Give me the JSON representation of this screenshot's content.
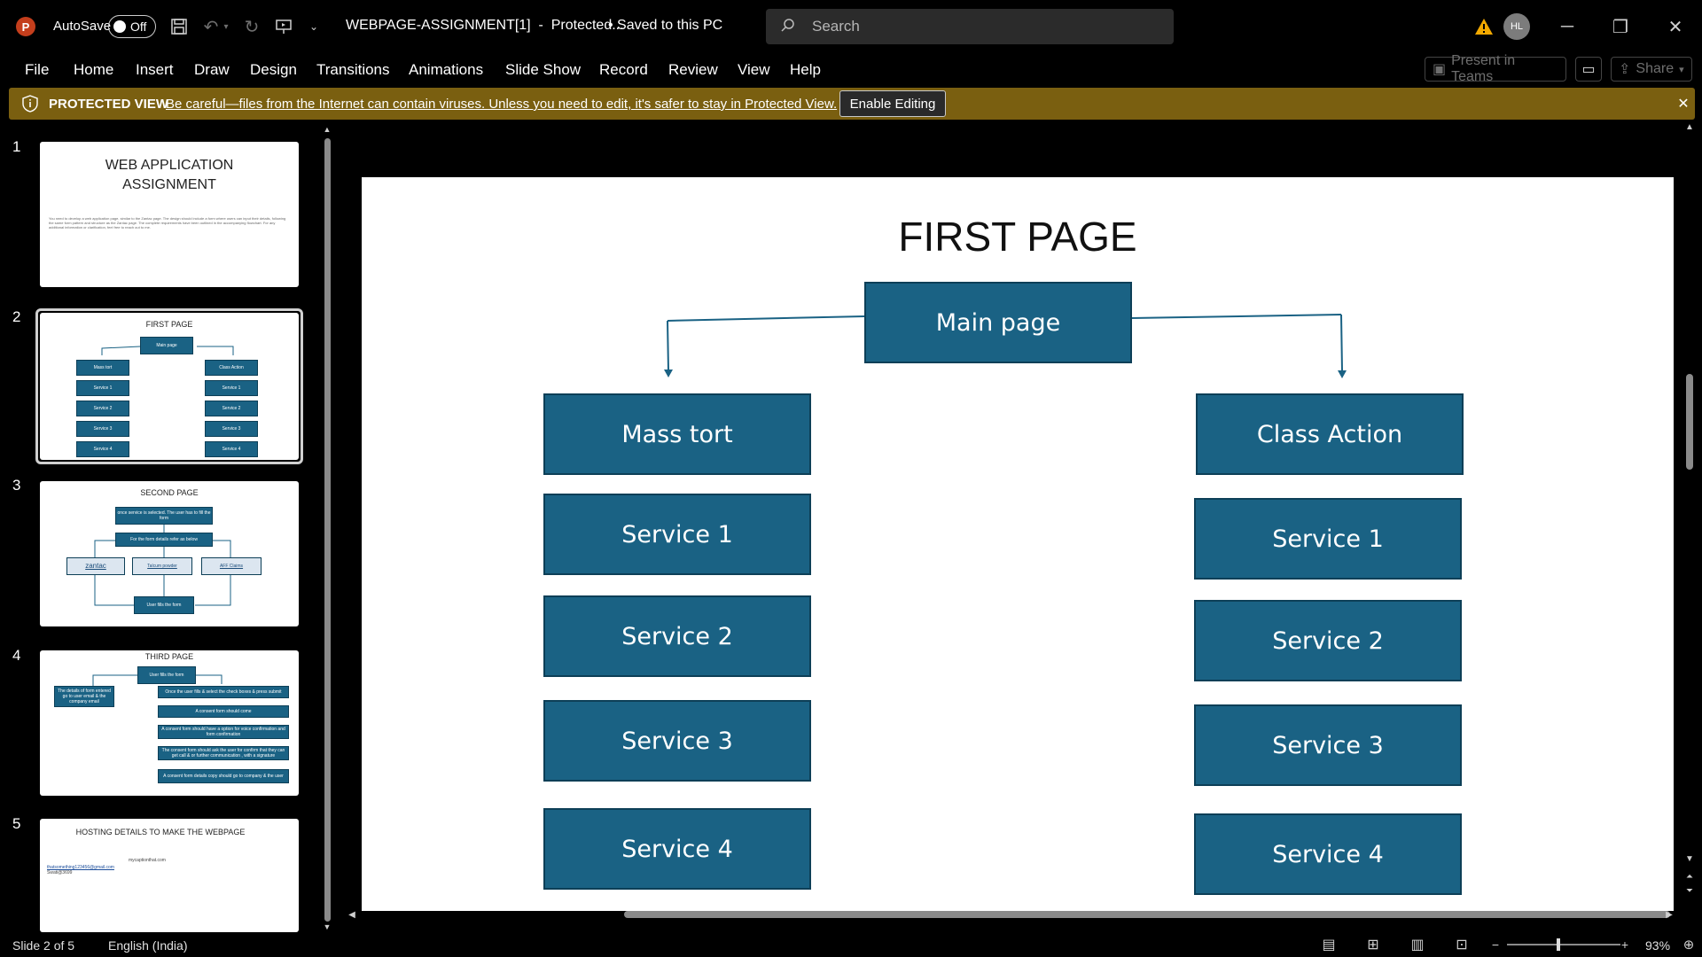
{
  "titlebar": {
    "autosave_label": "AutoSave",
    "autosave_state": "Off",
    "doc_title": "WEBPAGE-ASSIGNMENT[1]  -  Protected...",
    "save_status": "• Saved to this PC",
    "search_placeholder": "Search",
    "avatar_initials": "HL"
  },
  "menu": {
    "items": [
      "File",
      "Home",
      "Insert",
      "Draw",
      "Design",
      "Transitions",
      "Animations",
      "Slide Show",
      "Record",
      "Review",
      "View",
      "Help"
    ],
    "present_in_teams": "Present in Teams",
    "share": "Share"
  },
  "protected_view": {
    "label": "PROTECTED VIEW",
    "message": "Be careful—files from the Internet can contain viruses. Unless you need to edit, it's safer to stay in Protected View.",
    "button": "Enable Editing"
  },
  "thumbnails": {
    "numbers": [
      "1",
      "2",
      "3",
      "4",
      "5"
    ],
    "t1_title": "WEB APPLICATION\nASSIGNMENT",
    "t1_body": "You need to develop a web application page, similar to the Zantac page. The design should include a form where users can input their details, following the same form pattern and structure as the Zantac page. The complete requirements have been outlined in the accompanying flowchart. For any additional information or clarification, feel free to reach out to me.",
    "t2_title": "FIRST PAGE",
    "t2_main": "Main page",
    "t2_left": [
      "Mass tort",
      "Service 1",
      "Service 2",
      "Service 3",
      "Service 4"
    ],
    "t2_right": [
      "Class Action",
      "Service 1",
      "Service 2",
      "Service 3",
      "Service 4"
    ],
    "t3_title": "SECOND PAGE",
    "t3_top": "once service is selected. The user has to fill the form",
    "t3_mid": "For the form details refer as below",
    "t3_links": [
      "zantac",
      "Talcum powder",
      "AFF Claims"
    ],
    "t3_bottom": "User fills the form",
    "t4_title": "THIRD PAGE",
    "t4_top": "User fills the form",
    "t4_left": "The details of form entered go to user email & the company email",
    "t4_right": [
      "Once the user fills & select the check boxes & press submit",
      "A consent form should come",
      "A consent form should have a option for voice confirmation and form confirmation",
      "The consent form should ask the user for confirm that they can get call & or further communication , with a signature",
      "A consent form details copy should go to company & the user"
    ],
    "t5_title": "HOSTING DETAILS TO MAKE THE WEBPAGE",
    "t5_line1": "mycaptionthat.com",
    "t5_line2": "thatsomething123456@gmail.com",
    "t5_line3": "Swati@3699"
  },
  "slide": {
    "title": "FIRST PAGE",
    "main": "Main page",
    "left": [
      "Mass tort",
      "Service 1",
      "Service 2",
      "Service 3",
      "Service 4"
    ],
    "right": [
      "Class Action",
      "Service 1",
      "Service 2",
      "Service 3",
      "Service 4"
    ]
  },
  "status": {
    "slide_counter": "Slide 2 of 5",
    "language": "English (India)",
    "zoom": "93%"
  },
  "colors": {
    "box_fill": "#1a6284",
    "box_border": "#0d3f57",
    "protected_bar": "#7a5f10",
    "connector": "#1a6284"
  }
}
